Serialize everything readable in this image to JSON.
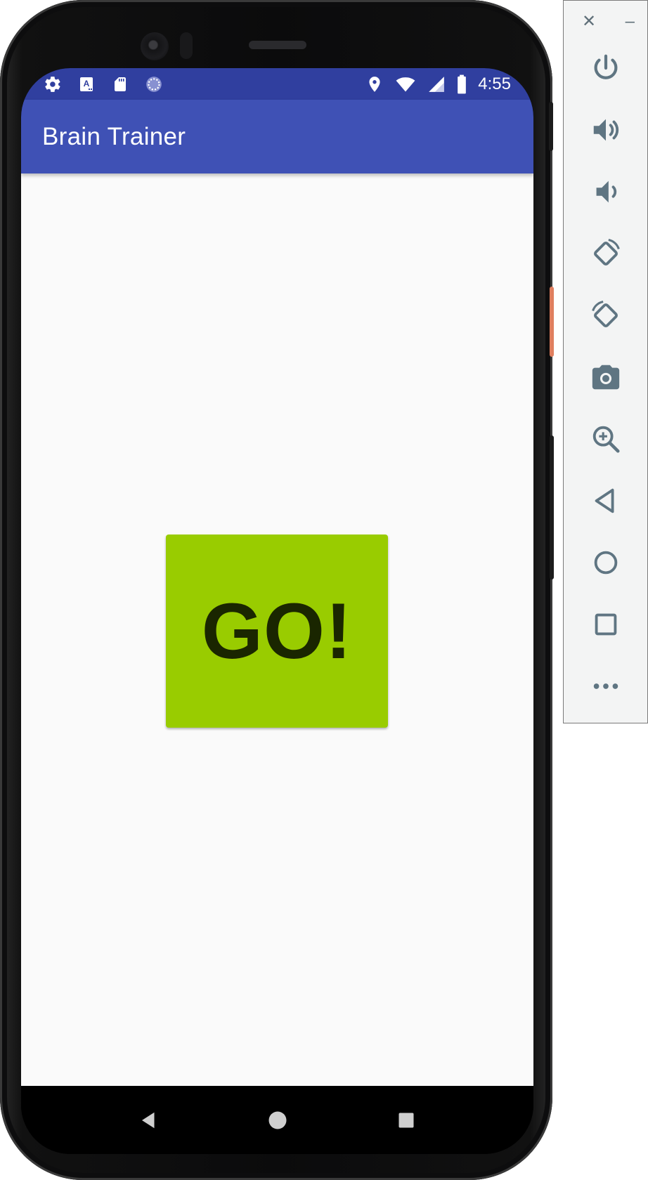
{
  "status_bar": {
    "time": "4:55",
    "left_icons": [
      "gear-icon",
      "keyboard-a-icon",
      "sd-card-icon",
      "loading-spinner-icon"
    ],
    "right_icons": [
      "location-pin-icon",
      "wifi-icon",
      "cell-signal-icon",
      "battery-icon"
    ],
    "background": "#303f9f"
  },
  "app_bar": {
    "title": "Brain Trainer",
    "background": "#3f51b5"
  },
  "main": {
    "go_button": {
      "label": "GO!",
      "background": "#99cc00"
    }
  },
  "nav_bar": {
    "buttons": [
      "back-icon",
      "home-icon",
      "recents-icon"
    ]
  },
  "emulator_toolbar": {
    "window_controls": {
      "close": "✕",
      "minimize": "–"
    },
    "tools": [
      "power-icon",
      "volume-up-icon",
      "volume-down-icon",
      "rotate-left-icon",
      "rotate-right-icon",
      "camera-icon",
      "zoom-icon",
      "back-icon",
      "home-icon",
      "overview-icon",
      "more-icon"
    ],
    "icon_color": "#5f7582"
  }
}
